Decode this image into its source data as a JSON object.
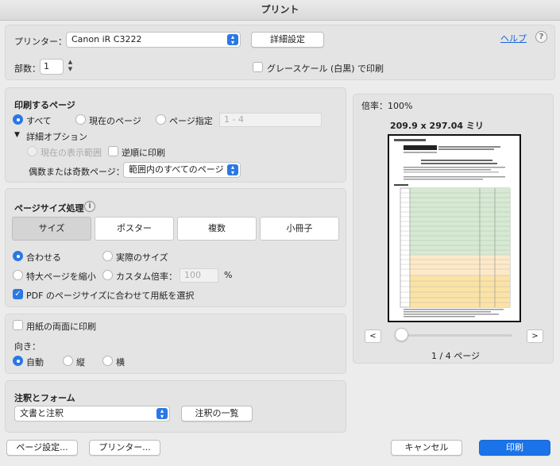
{
  "window": {
    "title": "プリント"
  },
  "printer": {
    "label": "プリンター：",
    "selected": "Canon iR C3222",
    "advanced_button": "詳細設定",
    "help_link": "ヘルプ",
    "help_icon": "?"
  },
  "copies": {
    "label": "部数：",
    "value": "1"
  },
  "grayscale": {
    "label": "グレースケール (白黒) で印刷",
    "checked": false
  },
  "pages_section": {
    "title": "印刷するページ",
    "options": [
      "すべて",
      "現在のページ",
      "ページ指定"
    ],
    "selected": "すべて",
    "range_placeholder": "1 - 4",
    "details_toggle": "詳細オプション",
    "current_view": "現在の表示範囲",
    "reverse": "逆順に印刷",
    "odd_even_label": "偶数または奇数ページ：",
    "odd_even_value": "範囲内のすべてのページ"
  },
  "size_section": {
    "title": "ページサイズ処理",
    "info_icon": "i",
    "tabs": [
      "サイズ",
      "ポスター",
      "複数",
      "小冊子"
    ],
    "active_tab": "サイズ",
    "fit": "合わせる",
    "actual": "実際のサイズ",
    "shrink": "特大ページを縮小",
    "custom_scale": "カスタム倍率：",
    "custom_value": "100",
    "percent": "%",
    "choose_paper": "PDF のページサイズに合わせて用紙を選択"
  },
  "duplex": {
    "label": "用紙の両面に印刷",
    "checked": false
  },
  "orientation": {
    "label": "向き：",
    "options": [
      "自動",
      "縦",
      "横"
    ],
    "selected": "自動"
  },
  "comments": {
    "title": "注釈とフォーム",
    "selected": "文書と注釈",
    "summarize_button": "注釈の一覧"
  },
  "preview": {
    "scale": "倍率：100%",
    "dimensions": "209.9 x 297.04 ミリ",
    "prev": "<",
    "next": ">",
    "page_indicator": "1 / 4 ページ",
    "slider_value": 0.0
  },
  "footer": {
    "page_setup": "ページ設定...",
    "printer": "プリンター...",
    "cancel": "キャンセル",
    "print": "印刷"
  },
  "colors": {
    "accent": "#2a78e6",
    "primary_button": "#1a73e8",
    "link": "#1a65d6"
  }
}
